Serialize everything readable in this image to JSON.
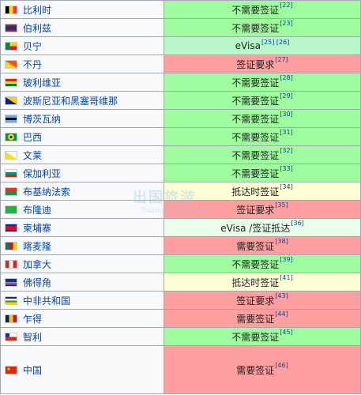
{
  "rows": [
    {
      "country": "比利时",
      "status": "不需要签证",
      "ref": "[22]",
      "cls": "s-free",
      "flag": "belgium-flag-icon",
      "colors": [
        "#000000",
        "#FDDA24",
        "#EF3340"
      ],
      "dir": "v"
    },
    {
      "country": "伯利兹",
      "status": "不需要签证",
      "ref": "[23]",
      "cls": "s-free",
      "flag": "belize-flag-icon",
      "colors": [
        "#CE1126",
        "#003F87",
        "#CE1126"
      ],
      "dir": "h3",
      "mid": "#ffffff"
    },
    {
      "country": "贝宁",
      "status": "eVisa",
      "ref": "[25] [26]",
      "cls": "s-evisa",
      "flag": "benin-flag-icon",
      "colors": [
        "#008751",
        "#FCD116",
        "#E8112D"
      ],
      "dir": "benin"
    },
    {
      "country": "不丹",
      "status": "签证要求",
      "ref": "[27]",
      "cls": "s-req",
      "flag": "bhutan-flag-icon",
      "colors": [
        "#FFD520",
        "#FF4E12"
      ],
      "dir": "diag"
    },
    {
      "country": "玻利维亚",
      "status": "不需要签证",
      "ref": "[28]",
      "cls": "s-free",
      "flag": "bolivia-flag-icon",
      "colors": [
        "#D52B1E",
        "#F9E300",
        "#007934"
      ],
      "dir": "h"
    },
    {
      "country": "波斯尼亚和黑塞哥维那",
      "status": "不需要签证",
      "ref": "[29]",
      "cls": "s-free",
      "flag": "bosnia-flag-icon",
      "colors": [
        "#002395",
        "#FECB00"
      ],
      "dir": "diag"
    },
    {
      "country": "博茨瓦纳",
      "status": "不需要签证",
      "ref": "[30]",
      "cls": "s-free",
      "flag": "botswana-flag-icon",
      "colors": [
        "#75AADB",
        "#000000",
        "#75AADB"
      ],
      "dir": "h"
    },
    {
      "country": "巴西",
      "status": "不需要签证",
      "ref": "[31]",
      "cls": "s-free",
      "flag": "brazil-flag-icon",
      "colors": [
        "#009C3B",
        "#FFDF00",
        "#002776"
      ],
      "dir": "brazil"
    },
    {
      "country": "文莱",
      "status": "不需要签证",
      "ref": "[32]",
      "cls": "s-free",
      "flag": "brunei-flag-icon",
      "colors": [
        "#F7E017",
        "#ffffff",
        "#000000"
      ],
      "dir": "diag"
    },
    {
      "country": "保加利亚",
      "status": "不需要签证",
      "ref": "[33]",
      "cls": "s-free",
      "flag": "bulgaria-flag-icon",
      "colors": [
        "#ffffff",
        "#00966E",
        "#D62612"
      ],
      "dir": "h"
    },
    {
      "country": "布基纳法索",
      "status": "抵达时签证",
      "ref": "[34]",
      "cls": "s-arr",
      "flag": "burkina-faso-flag-icon",
      "colors": [
        "#EF2B2D",
        "#009E49"
      ],
      "dir": "h2"
    },
    {
      "country": "布隆迪",
      "status": "签证要求",
      "ref": "[35]",
      "cls": "s-req",
      "flag": "burundi-flag-icon",
      "colors": [
        "#CE1126",
        "#1EB53A"
      ],
      "dir": "x"
    },
    {
      "country": "柬埔寨",
      "status": "eVisa /签证抵达",
      "ref": "[36]",
      "cls": "s-evisa2",
      "flag": "cambodia-flag-icon",
      "colors": [
        "#032EA1",
        "#E00025",
        "#032EA1"
      ],
      "dir": "h3"
    },
    {
      "country": "喀麦隆",
      "status": "需要签证",
      "ref": "[38]",
      "cls": "s-req",
      "flag": "cameroon-flag-icon",
      "colors": [
        "#007A5E",
        "#CE1126",
        "#FCD116"
      ],
      "dir": "v"
    },
    {
      "country": "加拿大",
      "status": "不需要签证",
      "ref": "[39]",
      "cls": "s-free",
      "flag": "canada-flag-icon",
      "colors": [
        "#D52B1E",
        "#ffffff",
        "#D52B1E"
      ],
      "dir": "v"
    },
    {
      "country": "佛得角",
      "status": "抵达时签证",
      "ref": "[41]",
      "cls": "s-arr",
      "flag": "cape-verde-flag-icon",
      "colors": [
        "#003893",
        "#ffffff",
        "#CF2027",
        "#003893"
      ],
      "dir": "cv"
    },
    {
      "country": "中非共和国",
      "status": "签证要求",
      "ref": "[43]",
      "cls": "s-req",
      "flag": "central-african-republic-flag-icon",
      "colors": [
        "#003082",
        "#ffffff",
        "#289728",
        "#FFCE00"
      ],
      "dir": "h"
    },
    {
      "country": "乍得",
      "status": "需要签证",
      "ref": "[44]",
      "cls": "s-req",
      "flag": "chad-flag-icon",
      "colors": [
        "#002664",
        "#FECB00",
        "#C60C30"
      ],
      "dir": "v"
    },
    {
      "country": "智利",
      "status": "不需要签证",
      "ref": "[45]",
      "cls": "s-free",
      "flag": "chile-flag-icon",
      "colors": [
        "#ffffff",
        "#D52B1E"
      ],
      "dir": "chile"
    },
    {
      "country": "中国",
      "status": "需要签证",
      "ref": "[46]",
      "cls": "s-req",
      "flag": "china-flag-icon",
      "colors": [
        "#DE2910",
        "#FFDE00"
      ],
      "dir": "china",
      "tall": true
    }
  ],
  "watermark": {
    "big": "出国旅游",
    "small": "Tourism Zhongguan"
  }
}
